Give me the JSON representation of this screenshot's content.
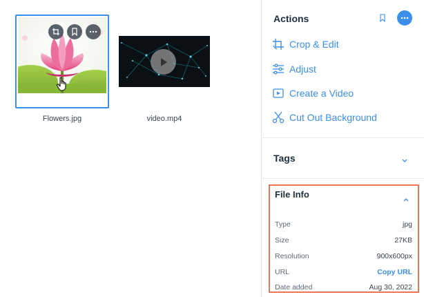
{
  "media": {
    "items": [
      {
        "name": "Flowers.jpg"
      },
      {
        "name": "video.mp4"
      }
    ]
  },
  "panel": {
    "actions_title": "Actions",
    "actions": [
      {
        "label": "Crop & Edit",
        "icon": "crop-icon"
      },
      {
        "label": "Adjust",
        "icon": "adjust-sliders-icon"
      },
      {
        "label": "Create a Video",
        "icon": "video-icon"
      },
      {
        "label": "Cut Out Background",
        "icon": "scissors-icon"
      }
    ],
    "tags_title": "Tags",
    "file_info": {
      "title": "File Info",
      "rows": [
        {
          "key": "Type",
          "value": "jpg"
        },
        {
          "key": "Size",
          "value": "27KB"
        },
        {
          "key": "Resolution",
          "value": "900x600px"
        },
        {
          "key": "URL",
          "value": "Copy URL"
        },
        {
          "key": "Date added",
          "value": "Aug 30, 2022"
        }
      ]
    }
  },
  "colors": {
    "accent": "#3b8eea",
    "highlight": "#f07453",
    "text": "#20303c"
  }
}
